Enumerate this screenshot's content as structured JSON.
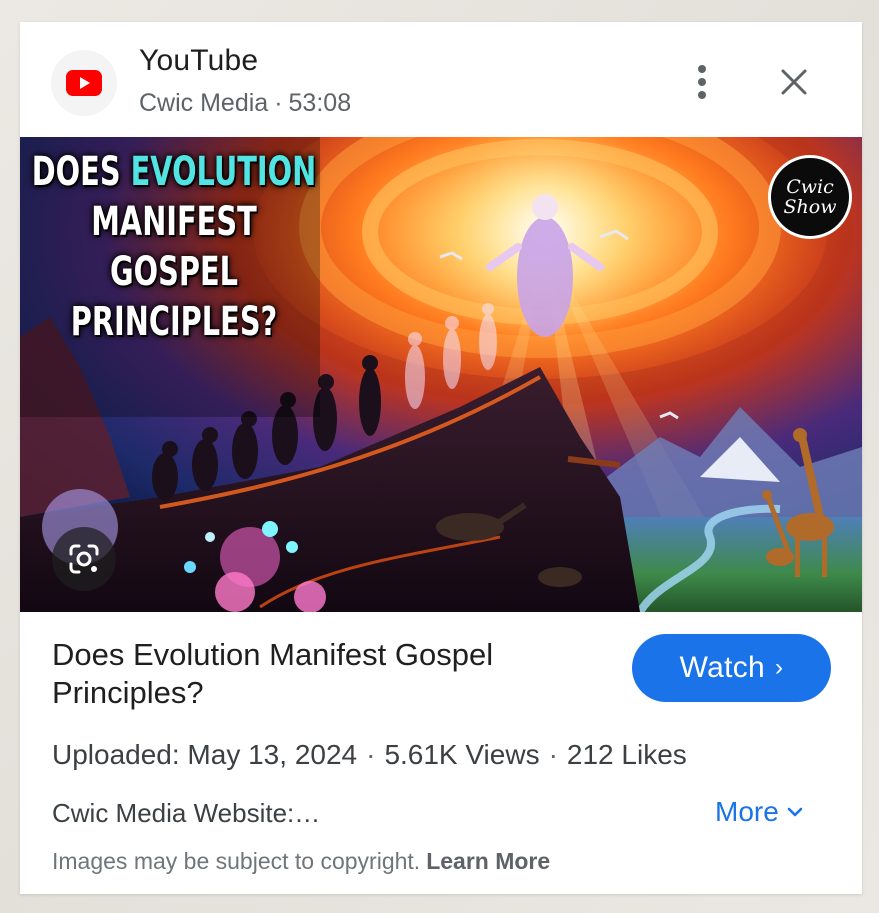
{
  "header": {
    "app_name": "YouTube",
    "channel": "Cwic Media",
    "separator": "·",
    "duration": "53:08",
    "logo_icon": "youtube-play-icon",
    "more_icon": "more-vert-icon",
    "close_icon": "close-icon"
  },
  "thumbnail": {
    "overlay_title_line1_plain": "DOES",
    "overlay_title_line1_accent": "EVOLUTION",
    "overlay_title_line2": "MANIFEST",
    "overlay_title_line3": "GOSPEL",
    "overlay_title_line4": "PRINCIPLES?",
    "badge_line1": "Cwic",
    "badge_line2": "Show",
    "lens_icon": "google-lens-icon"
  },
  "video": {
    "title": "Does Evolution Manifest Gospel Principles?",
    "watch_label": "Watch",
    "watch_chevron": "›",
    "uploaded": "Uploaded: May 13, 2024",
    "views": "5.61K Views",
    "likes": "212 Likes",
    "separator": "·",
    "description": "Cwic Media Website:…",
    "more_label": "More"
  },
  "footer": {
    "copyright_text": "Images may be subject to copyright.",
    "learn_more": "Learn More"
  },
  "colors": {
    "accent_blue": "#1a73e8",
    "youtube_red": "#ff0000",
    "title_accent": "#52e3e3"
  }
}
